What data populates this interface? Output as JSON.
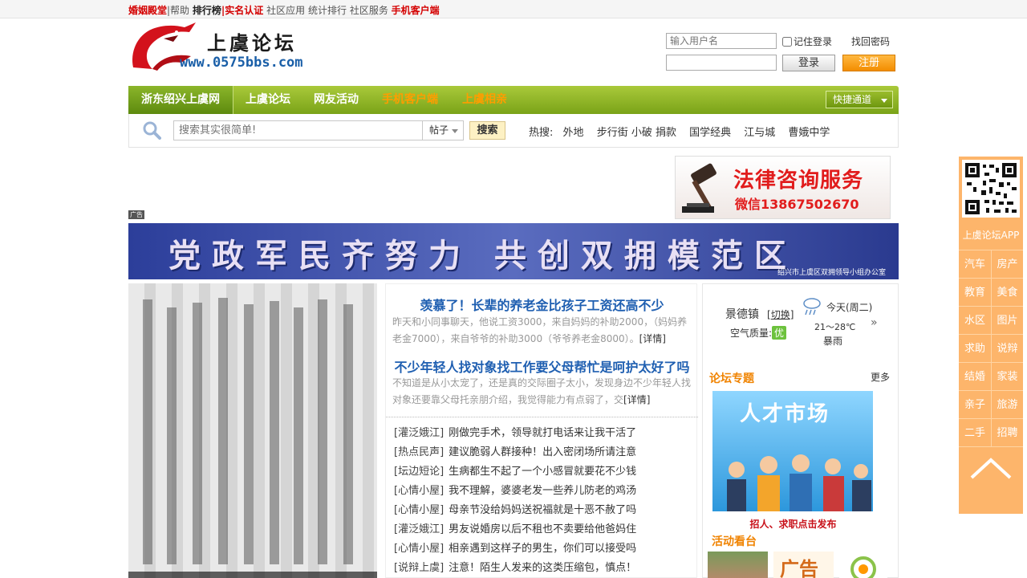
{
  "topbar": {
    "items": [
      {
        "label": "婚姻殿堂",
        "style": "red"
      },
      {
        "label": "|帮助",
        "style": "gray"
      },
      {
        "label": "排行榜",
        "style": "dark"
      },
      {
        "label": "|实名认证",
        "style": "red"
      },
      {
        "label": "社区应用",
        "style": "gray"
      },
      {
        "label": "统计排行",
        "style": "gray"
      },
      {
        "label": "社区服务",
        "style": "gray"
      },
      {
        "label": "手机客户端",
        "style": "red"
      }
    ]
  },
  "header": {
    "logo_text": "上虞论坛",
    "logo_url": "www.0575bbs.com"
  },
  "login": {
    "username_placeholder": "输入用户名",
    "password_value": "",
    "remember_label": "记住登录",
    "find_password": "找回密码",
    "login_button": "登录",
    "register_button": "注册"
  },
  "nav": {
    "items": [
      {
        "label": "浙东绍兴上虞网",
        "active": true,
        "orange": false
      },
      {
        "label": "上虞论坛",
        "active": false,
        "orange": false
      },
      {
        "label": "网友活动",
        "active": false,
        "orange": false
      },
      {
        "label": "手机客户端",
        "active": false,
        "orange": true
      },
      {
        "label": "上虞相亲",
        "active": false,
        "orange": true
      }
    ],
    "quick_label": "快捷通道"
  },
  "search": {
    "placeholder": "搜索其实很简单!",
    "type_label": "帖子",
    "button": "搜索",
    "hot_label": "热搜:",
    "hot_keywords": [
      "外地",
      "步行街 小破 捐款",
      "国学经典",
      "江与城",
      "曹娥中学"
    ]
  },
  "ads": {
    "law_title": "法律咨询服务",
    "law_contact": "微信13867502670",
    "ad_tag": "广告",
    "banner_text": "党政军民齐努力  共创双拥模范区",
    "banner_sub": "绍兴市上虞区双拥领导小组办公室"
  },
  "news": {
    "headlines": [
      {
        "title": "羡慕了！长辈的养老金比孩子工资还高不少",
        "summary": "昨天和小同事聊天，他说工资3000，来自妈妈的补助2000，（妈妈养老金7000），来自爷爷的补助3000（爷爷养老金8000）。",
        "more": "[详情]"
      },
      {
        "title": "不少年轻人找对象找工作要父母帮忙是呵护太好了吗",
        "summary": "不知道是从小太宠了，还是真的交际圈子太小，发现身边不少年轻人找对象还要靠父母托亲朋介绍，我觉得能力有点弱了，交",
        "more": "[详情]"
      }
    ],
    "posts": [
      {
        "cat": "[灌泛娥江]",
        "title": "刚做完手术，领导就打电话来让我干活了"
      },
      {
        "cat": "[热点民声]",
        "title": "建议脆弱人群接种！出入密闭场所请注意"
      },
      {
        "cat": "[坛边短论]",
        "title": "生病都生不起了一个小感冒就要花不少钱"
      },
      {
        "cat": "[心情小屋]",
        "title": "我不理解，婆婆老发一些养儿防老的鸡汤"
      },
      {
        "cat": "[心情小屋]",
        "title": "母亲节没给妈妈送祝福就是十恶不赦了吗"
      },
      {
        "cat": "[灌泛娥江]",
        "title": "男友说婚房以后不租也不卖要给他爸妈住"
      },
      {
        "cat": "[心情小屋]",
        "title": "相亲遇到这样子的男生，你们可以接受吗"
      },
      {
        "cat": "[说辩上虞]",
        "title": "注意！陌生人发来的这类压缩包，慎点！"
      }
    ]
  },
  "weather": {
    "city": "景德镇",
    "switch": "切换",
    "air_label": "空气质量:",
    "air_value": "优",
    "day": "今天(周二)",
    "temp": "21～28℃",
    "desc": "暴雨"
  },
  "topics": {
    "title": "论坛专题",
    "more": "更多",
    "image_title": "人才市场",
    "caption": "招人、求职点击发布"
  },
  "activity": {
    "title": "活动看台",
    "ad_text": "广告"
  },
  "sidebar": {
    "app_label": "上虞论坛APP",
    "cells": [
      "汽车",
      "房产",
      "教育",
      "美食",
      "水区",
      "图片",
      "求助",
      "说辩",
      "结婚",
      "家装",
      "亲子",
      "旅游",
      "二手",
      "招聘"
    ]
  }
}
